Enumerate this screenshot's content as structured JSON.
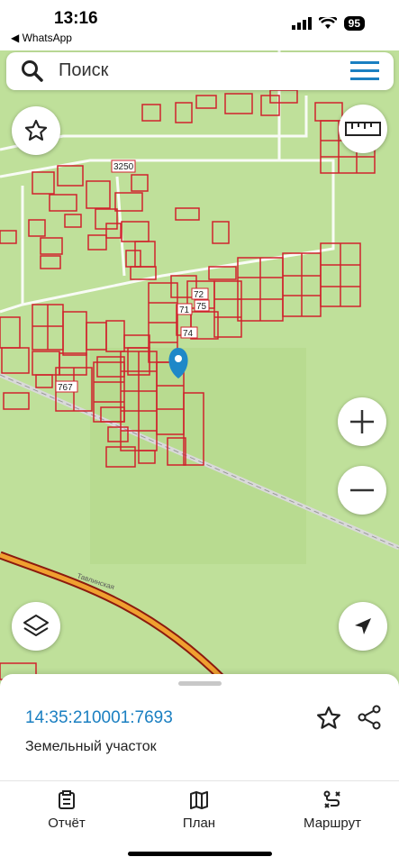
{
  "status_bar": {
    "time": "13:16",
    "back_app": "◀ WhatsApp",
    "battery": "95"
  },
  "search": {
    "placeholder": "Поиск"
  },
  "map": {
    "labels": [
      "3250",
      "72",
      "71",
      "75",
      "74",
      "767"
    ],
    "road_label": "Тавлинская"
  },
  "sheet": {
    "cadastral_number": "14:35:210001:7693",
    "parcel_type": "Земельный участок"
  },
  "tabs": [
    {
      "label": "Отчёт",
      "icon": "report-icon"
    },
    {
      "label": "План",
      "icon": "map-icon"
    },
    {
      "label": "Маршрут",
      "icon": "route-icon"
    }
  ],
  "colors": {
    "map_bg": "#bfe09a",
    "parcel_stroke": "#d0222c",
    "accent": "#1a7fc1",
    "pin": "#1e88c8",
    "road": "#e04a2a"
  }
}
